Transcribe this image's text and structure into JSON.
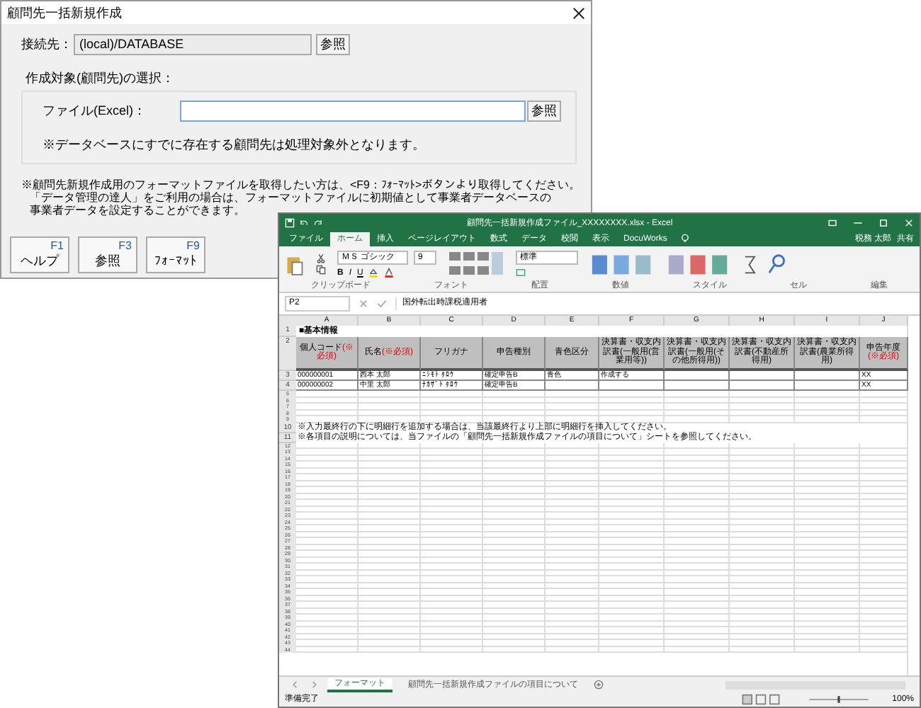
{
  "dialog": {
    "title": "顧問先一括新規作成",
    "connection": {
      "label": "接続先：",
      "value": "(local)/DATABASE",
      "button": "参照"
    },
    "target_group": {
      "title": "作成対象(顧問先)の選択：",
      "file_label": "ファイル(Excel)：",
      "button": "参照",
      "note": "※データベースにすでに存在する顧問先は処理対象外となります。"
    },
    "notes": [
      "※顧問先新規作成用のフォーマットファイルを取得したい方は、<F9：ﾌｫｰﾏｯﾄ>ボタンより取得してください。",
      "「データ管理の達人」をご利用の場合は、フォーマットファイルに初期値として事業者データベースの",
      "事業者データを設定することができます。"
    ],
    "function_keys": [
      {
        "key": "F1",
        "label": "ヘルプ"
      },
      {
        "key": "F3",
        "label": "参照"
      },
      {
        "key": "F9",
        "label": "ﾌｫｰﾏｯﾄ"
      }
    ]
  },
  "excel": {
    "title": "顧問先一括新規作成ファイル_XXXXXXXX.xlsx - Excel",
    "user": "税務 太郎",
    "share": "共有",
    "tabs": [
      {
        "label": "ファイル",
        "selected": false
      },
      {
        "label": "ホーム",
        "selected": true
      },
      {
        "label": "挿入",
        "selected": false
      },
      {
        "label": "ページレイアウト",
        "selected": false
      },
      {
        "label": "数式",
        "selected": false
      },
      {
        "label": "データ",
        "selected": false
      },
      {
        "label": "校閲",
        "selected": false
      },
      {
        "label": "表示",
        "selected": false
      },
      {
        "label": "DocuWorks",
        "selected": false
      }
    ],
    "ribbon": {
      "font_name": "ＭＳ ゴシック",
      "font_size": "9",
      "number_format": "標準",
      "format_buttons": [
        "B",
        "I",
        "U"
      ],
      "groups": [
        "クリップボード",
        "フォント",
        "配置",
        "数値",
        "スタイル",
        "セル",
        "編集"
      ]
    },
    "name_box": "P2",
    "formula": "国外転出時課税適用者",
    "columns": [
      "A",
      "B",
      "C",
      "D",
      "E",
      "F",
      "G",
      "H",
      "I",
      "J"
    ],
    "rows": [
      {
        "number": "1",
        "kind": "title",
        "text": "■基本情報"
      },
      {
        "number": "2",
        "kind": "header",
        "cells": [
          {
            "text": "個人コード",
            "required": "(※必須)"
          },
          {
            "text": "氏名",
            "required": "(※必須)"
          },
          {
            "text": "フリガナ"
          },
          {
            "text": "申告種別"
          },
          {
            "text": "青色区分"
          },
          {
            "text": "決算書・収支内訳書(一般用(営業用等))"
          },
          {
            "text": "決算書・収支内訳書(一般用(その他所得用))"
          },
          {
            "text": "決算書・収支内訳書(不動産所得用)"
          },
          {
            "text": "決算書・収支内訳書(農業所得用)"
          },
          {
            "text": "申告年度",
            "required": "(※必須)"
          }
        ]
      },
      {
        "number": "3",
        "kind": "data",
        "cells": {
          "A": "000000001",
          "B": "西本 太郎",
          "C": "ﾆｼﾓﾄ ﾀﾛｳ",
          "D": "確定申告B",
          "E": "青色",
          "F": "作成する",
          "J": "XX"
        }
      },
      {
        "number": "4",
        "kind": "data",
        "cells": {
          "A": "000000002",
          "B": "中里 太郎",
          "C": "ﾅｶｻﾞﾄ ﾀﾛｳ",
          "D": "確定申告B",
          "J": "XX"
        }
      },
      {
        "number": "5",
        "kind": "blank"
      },
      {
        "number": "6",
        "kind": "blank"
      },
      {
        "number": "7",
        "kind": "blank"
      },
      {
        "number": "8",
        "kind": "blank"
      },
      {
        "number": "9",
        "kind": "blank"
      },
      {
        "number": "10",
        "kind": "note",
        "text": "※入力最終行の下に明細行を追加する場合は、当該最終行より上部に明細行を挿入してください。"
      },
      {
        "number": "11",
        "kind": "note",
        "text": "※各項目の説明については、当ファイルの「顧問先一括新規作成ファイルの項目について」シートを参照してください。"
      },
      {
        "number": "12",
        "kind": "blank"
      },
      {
        "number": "13",
        "kind": "blank"
      },
      {
        "number": "14",
        "kind": "blank"
      },
      {
        "number": "15",
        "kind": "blank"
      },
      {
        "number": "16",
        "kind": "blank"
      },
      {
        "number": "17",
        "kind": "blank"
      },
      {
        "number": "18",
        "kind": "blank"
      },
      {
        "number": "19",
        "kind": "blank"
      },
      {
        "number": "20",
        "kind": "blank"
      },
      {
        "number": "21",
        "kind": "blank"
      },
      {
        "number": "22",
        "kind": "blank"
      },
      {
        "number": "23",
        "kind": "blank"
      },
      {
        "number": "24",
        "kind": "blank"
      },
      {
        "number": "25",
        "kind": "blank"
      },
      {
        "number": "26",
        "kind": "blank"
      },
      {
        "number": "27",
        "kind": "blank"
      },
      {
        "number": "28",
        "kind": "blank"
      },
      {
        "number": "29",
        "kind": "blank"
      },
      {
        "number": "30",
        "kind": "blank"
      },
      {
        "number": "31",
        "kind": "blank"
      },
      {
        "number": "32",
        "kind": "blank"
      },
      {
        "number": "33",
        "kind": "blank"
      },
      {
        "number": "34",
        "kind": "blank"
      },
      {
        "number": "35",
        "kind": "blank"
      },
      {
        "number": "36",
        "kind": "blank"
      },
      {
        "number": "37",
        "kind": "blank"
      },
      {
        "number": "38",
        "kind": "blank"
      },
      {
        "number": "39",
        "kind": "blank"
      },
      {
        "number": "40",
        "kind": "blank"
      },
      {
        "number": "41",
        "kind": "blank"
      },
      {
        "number": "42",
        "kind": "blank"
      },
      {
        "number": "43",
        "kind": "blank"
      },
      {
        "number": "44",
        "kind": "blank"
      }
    ],
    "sheet_tabs": [
      {
        "label": "フォーマット",
        "selected": true
      },
      {
        "label": "顧問先一括新規作成ファイルの項目について",
        "selected": false
      }
    ],
    "status": "準備完了",
    "zoom_slider": {
      "level": 0.5
    },
    "zoom": "100%"
  }
}
